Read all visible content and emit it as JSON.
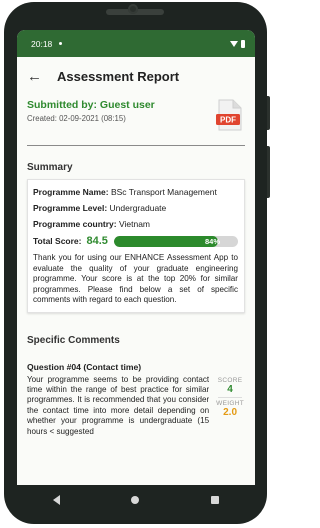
{
  "status_bar": {
    "time": "20:18"
  },
  "app_bar": {
    "back_icon": "arrow-left-icon",
    "title": "Assessment Report"
  },
  "submission": {
    "submitted_by": "Submitted by: Guest user",
    "created": "Created: 02-09-2021 (08:15)",
    "pdf_icon_label": "PDF"
  },
  "summary": {
    "heading": "Summary",
    "programme_name_label": "Programme Name:",
    "programme_name": "BSc Transport Management",
    "programme_level_label": "Programme Level:",
    "programme_level": "Undergraduate",
    "programme_country_label": "Programme country:",
    "programme_country": "Vietnam",
    "total_score_label": "Total Score:",
    "total_score": "84.5",
    "progress_text": "84%",
    "progress_fraction": 0.84,
    "message": "Thank you for using our ENHANCE Assessment App to evaluate the quality of your graduate engineering programme. Your score is at the top 20% for similar programmes. Please find below a set of specific comments with regard to each question."
  },
  "specific_comments": {
    "heading": "Specific Comments",
    "questions": [
      {
        "title": "Question #04 (Contact time)",
        "text": "Your programme seems to be providing contact time within the range of best practice for similar programmes. It is recommended that you consider the contact time into more detail depending on whether your programme is undergraduate (15 hours < suggested",
        "score_label": "SCORE",
        "score": "4",
        "weight_label": "WEIGHT",
        "weight": "2.0"
      }
    ]
  },
  "colors": {
    "status_bar": "#2f6a33",
    "accent_green": "#2f8a2f",
    "weight_orange": "#e39a14",
    "pdf_red": "#e0442f"
  }
}
